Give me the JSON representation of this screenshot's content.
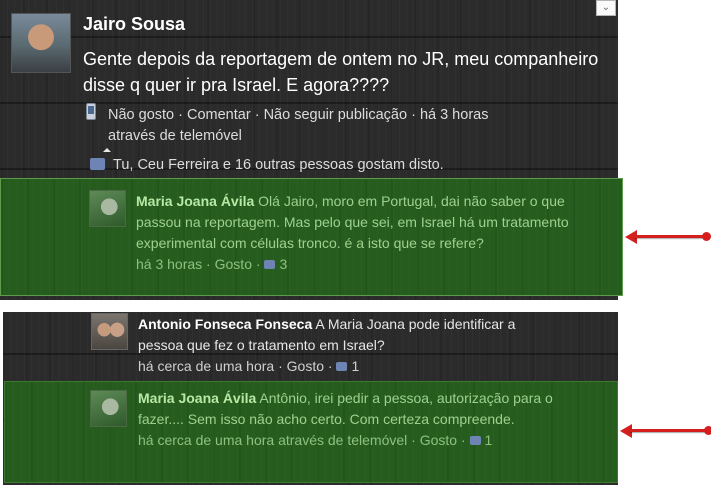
{
  "post": {
    "author": "Jairo Sousa",
    "text": "Gente depois da reportagem de ontem no JR, meu companheiro disse q quer ir pra Israel. E agora????",
    "actions": {
      "unlike": "Não gosto",
      "comment": "Comentar",
      "unfollow": "Não seguir publicação",
      "time": "há 3 horas",
      "via": "através de telemóvel"
    },
    "likes_text": "Tu, Ceu Ferreira e 16 outras pessoas gostam disto."
  },
  "comments": [
    {
      "author": "Maria Joana Ávila",
      "text": "Olá Jairo, moro em Portugal, dai não saber o que passou na reportagem. Mas pelo que sei, em Israel há um tratamento experimental com células tronco. é a isto que se refere?",
      "time": "há 3 horas",
      "like": "Gosto",
      "likes": "3"
    },
    {
      "author": "Antonio Fonseca Fonseca",
      "text": "A Maria Joana pode identificar a pessoa que fez o tratamento em Israel?",
      "time": "há cerca de uma hora",
      "like": "Gosto",
      "likes": "1"
    },
    {
      "author": "Maria Joana Ávila",
      "text": "Antônio, irei pedir a pessoa, autorização para o fazer.... Sem isso não acho certo. Com certeza compreende.",
      "time": "há cerca de uma hora através de telemóvel",
      "like": "Gosto",
      "likes": "1"
    }
  ],
  "icons": {
    "dropdown": "chevron-down-icon",
    "phone": "mobile-phone-icon",
    "like": "thumbs-up-icon",
    "arrow": "red-arrow-left-icon"
  },
  "colors": {
    "panel": "#2b2b2b",
    "highlight_green": "#265d1f",
    "arrow_red": "#d51f1f",
    "name_green": "#b8e8a6"
  },
  "sep": " · "
}
